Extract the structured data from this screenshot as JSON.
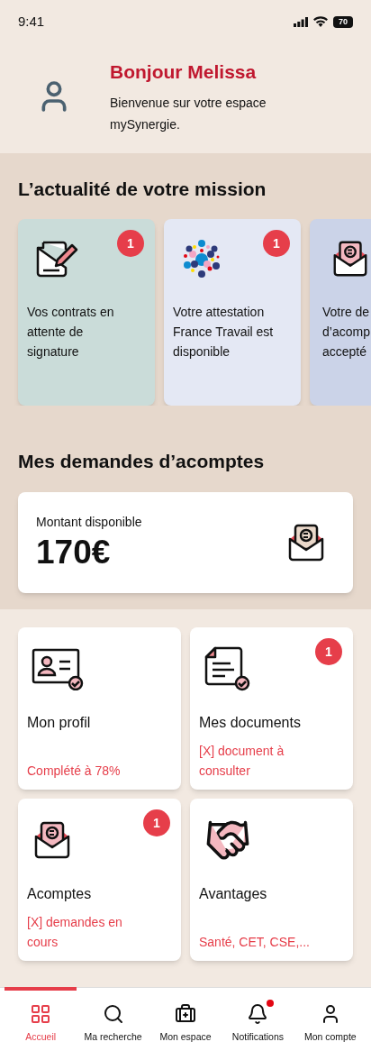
{
  "status_bar": {
    "time": "9:41",
    "battery": "70"
  },
  "header": {
    "greeting": "Bonjour Melissa",
    "subtitle": "Bienvenue sur votre espace mySynergie."
  },
  "news": {
    "title": "L’actualité de votre mission",
    "cards": [
      {
        "kind": "contract",
        "lines": [
          "Vos contrats en",
          "attente de",
          "signature"
        ],
        "badge": "1",
        "color": "#cadcd9"
      },
      {
        "kind": "dots",
        "lines": [
          "Votre attestation",
          "France Travail est",
          "disponible"
        ],
        "badge": "1",
        "color": "#e4e8f4"
      },
      {
        "kind": "envelope",
        "lines": [
          "Votre de",
          "d’acomp",
          "accepté"
        ],
        "color": "#cbd3e8"
      }
    ]
  },
  "advances": {
    "title": "Mes demandes d’acomptes",
    "label": "Montant disponible",
    "amount": "170€"
  },
  "tiles": [
    {
      "kind": "id",
      "title": "Mon profil",
      "detail": "Complété à 78%"
    },
    {
      "kind": "document",
      "title": "Mes documents",
      "detail": "[X] document à consulter",
      "badge": "1"
    },
    {
      "kind": "envelope",
      "title": "Acomptes",
      "detail": "[X] demandes en cours",
      "badge": "1"
    },
    {
      "kind": "handshake",
      "title": "Avantages",
      "detail": "Santé, CET, CSE,..."
    }
  ],
  "nav": [
    {
      "kind": "grid",
      "label": "Accueil",
      "selected": true
    },
    {
      "kind": "search",
      "label": "Ma recherche",
      "selected": false
    },
    {
      "kind": "briefcase",
      "label": "Mon espace",
      "selected": false
    },
    {
      "kind": "bell",
      "label": "Notifications",
      "selected": false,
      "dot": true
    },
    {
      "kind": "user",
      "label": "Mon compte",
      "selected": false
    }
  ]
}
